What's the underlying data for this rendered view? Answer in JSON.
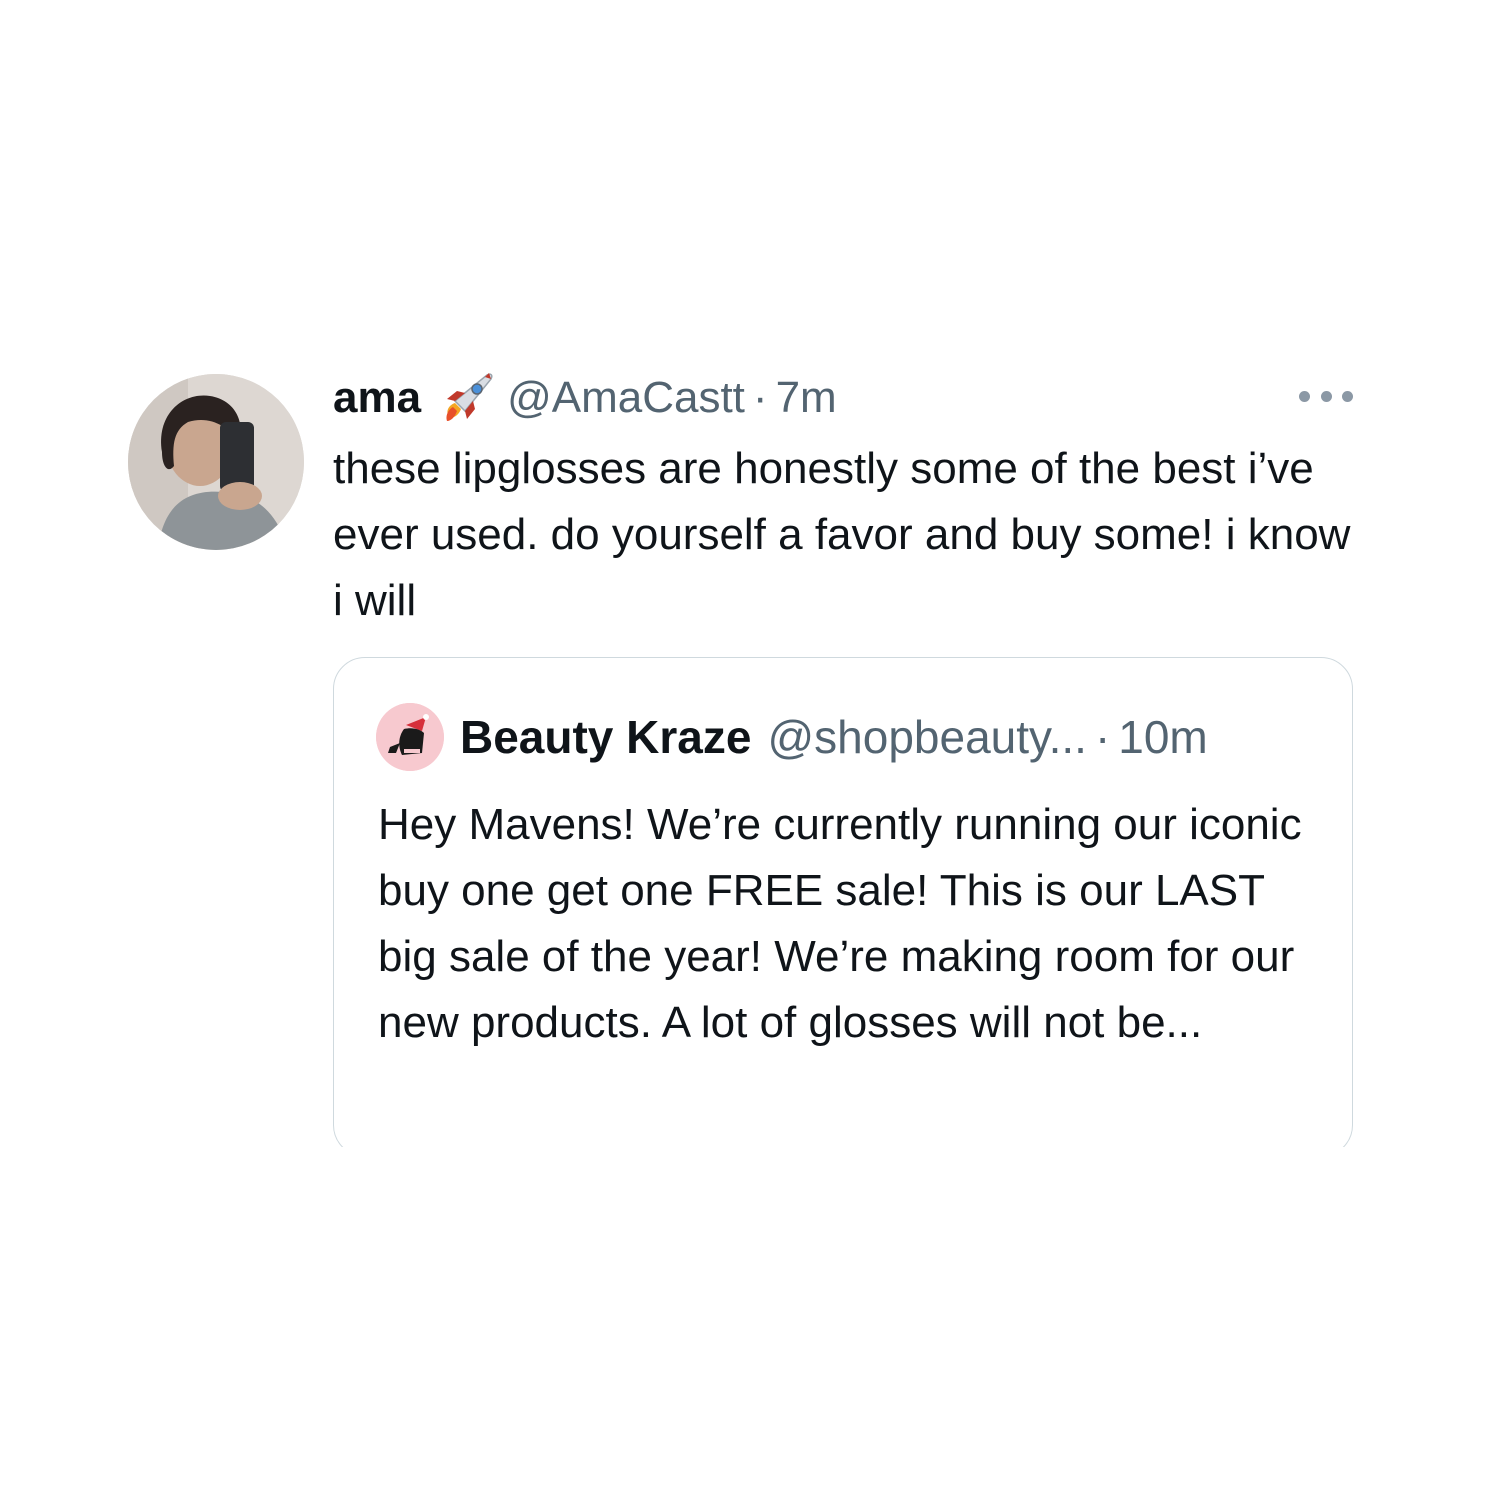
{
  "tweet": {
    "author_name": "ama",
    "author_emoji": "rocket-icon",
    "handle": "@AmaCastt",
    "separator": "·",
    "time": "7m",
    "text": "these lipglosses are honestly some of the best i’ve ever used. do yourself a favor and buy some! i know i will",
    "more_icon": "more-horizontal-icon"
  },
  "quoted_tweet": {
    "author_name": "Beauty Kraze",
    "handle": "@shopbeauty...",
    "separator": "·",
    "time": "10m",
    "text": "Hey Mavens! We’re currently running our iconic buy one get one FREE sale! This is our LAST big sale of the year! We’re making room for our new products. A lot of glosses will not be..."
  },
  "colors": {
    "text_primary": "#0f1419",
    "text_secondary": "#536471",
    "border": "#cfd9de",
    "quote_avatar_bg": "#f7c9cf"
  }
}
